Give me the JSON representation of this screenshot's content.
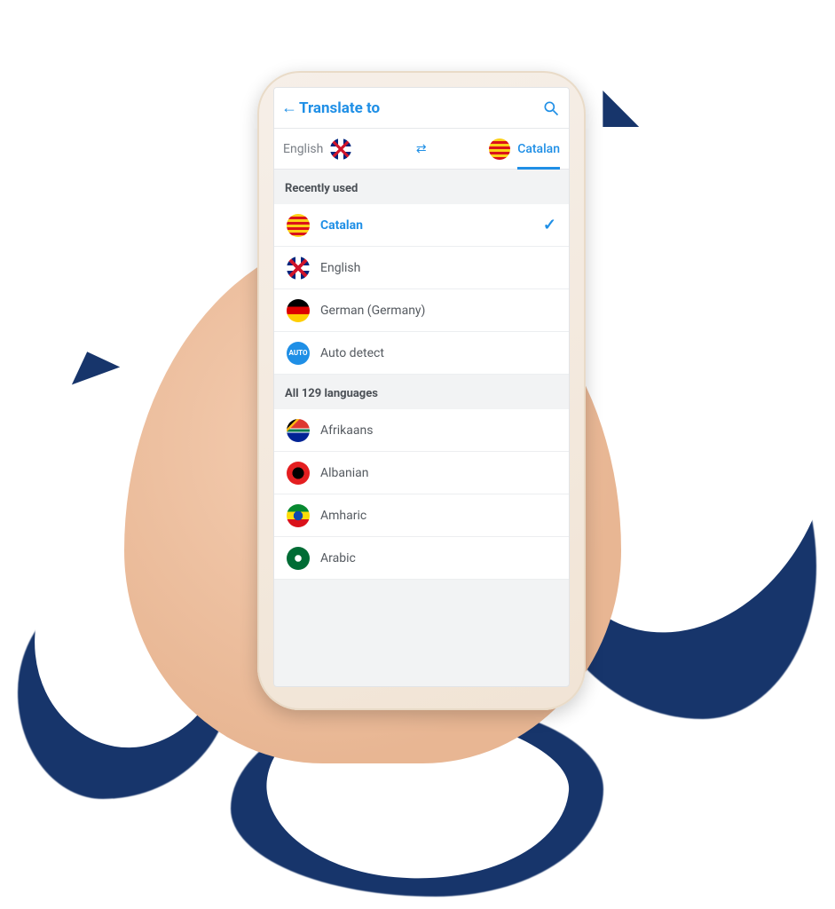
{
  "header": {
    "title": "Translate to"
  },
  "pair": {
    "from_label": "English",
    "to_label": "Catalan"
  },
  "sections": {
    "recent_header": "Recently used",
    "all_header": "All 129 languages"
  },
  "recent": [
    {
      "name": "Catalan",
      "flag": "catalan",
      "selected": true
    },
    {
      "name": "English",
      "flag": "uk",
      "selected": false
    },
    {
      "name": "German (Germany)",
      "flag": "germany",
      "selected": false
    },
    {
      "name": "Auto detect",
      "flag": "auto",
      "selected": false
    }
  ],
  "all": [
    {
      "name": "Afrikaans",
      "flag": "za"
    },
    {
      "name": "Albanian",
      "flag": "albania"
    },
    {
      "name": "Amharic",
      "flag": "ethiopia"
    },
    {
      "name": "Arabic",
      "flag": "arabic"
    }
  ],
  "auto_badge": "AUTO"
}
